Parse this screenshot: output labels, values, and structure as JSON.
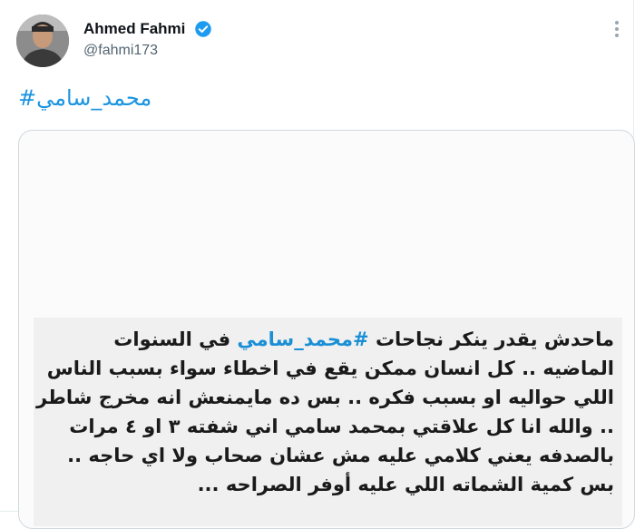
{
  "tweet": {
    "author_name": "Ahmed Fahmi",
    "author_handle": "@fahmi173",
    "verified": true,
    "hashtag_text": "#محمد_سامي"
  },
  "image_text": {
    "line1_pre": "ماحدش يقدر ينكر نجاحات ",
    "line1_hashtag": "#محمد_سامي",
    "line1_post": " في السنوات",
    "line2": "الماضيه .. كل انسان ممكن يقع في اخطاء سواء بسبب الناس",
    "line3": "اللي حواليه او بسبب فكره ..  بس ده مايمنعش انه مخرج شاطر",
    "line4": ".. والله انا كل علاقتي بمحمد سامي اني شفته ٣ او ٤ مرات",
    "line5": "بالصدفه يعني كلامي عليه مش عشان صحاب ولا اي حاجه ..",
    "line6": "بس كمية الشماته اللي عليه أوفر الصراحه ..."
  },
  "colors": {
    "link": "#1b95e0",
    "verified_badge": "#1d9bf0",
    "name": "#0f1419",
    "handle": "#536471"
  },
  "icons": {
    "verified": "verified-badge-icon",
    "more": "more-options-icon"
  }
}
